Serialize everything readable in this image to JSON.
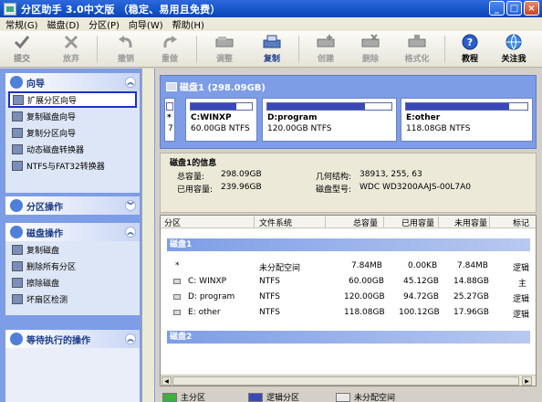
{
  "window": {
    "title": "分区助手 3.0中文版 （稳定、易用且免费）"
  },
  "menu": [
    "常规(G)",
    "磁盘(D)",
    "分区(P)",
    "向导(W)",
    "帮助(H)"
  ],
  "toolbar": {
    "commit": "提交",
    "discard": "放弃",
    "undo": "撤销",
    "redo": "重做",
    "resize": "调整",
    "copy": "复制",
    "create": "创建",
    "delete": "删除",
    "format": "格式化",
    "tutorial": "教程",
    "follow": "关注我"
  },
  "left": {
    "wizard": {
      "title": "向导",
      "items": [
        "扩展分区向导",
        "复制磁盘向导",
        "复制分区向导",
        "动态磁盘转换器",
        "NTFS与FAT32转换器"
      ]
    },
    "partition_ops": {
      "title": "分区操作"
    },
    "disk_ops": {
      "title": "磁盘操作",
      "items": [
        "复制磁盘",
        "删除所有分区",
        "擦除磁盘",
        "坏扇区检测"
      ]
    },
    "pending": {
      "title": "等待执行的操作"
    }
  },
  "diskmap": {
    "title": "磁盘1  (298.09GB)",
    "parts": [
      {
        "label": "*",
        "size": "7"
      },
      {
        "label": "C:WINXP",
        "size": "60.00GB NTFS",
        "used": 0.75
      },
      {
        "label": "D:program",
        "size": "120.00GB NTFS",
        "used": 0.79
      },
      {
        "label": "E:other",
        "size": "118.08GB NTFS",
        "used": 0.85
      }
    ]
  },
  "info": {
    "title": "磁盘1的信息",
    "total_label": "总容量:",
    "total": "298.09GB",
    "used_label": "已用容量:",
    "used": "239.96GB",
    "geo_label": "几何结构:",
    "geo": "38913, 255, 63",
    "model_label": "磁盘型号:",
    "model": "WDC WD3200AAJS-00L7A0"
  },
  "table": {
    "headers": [
      "分区",
      "文件系统",
      "总容量",
      "已用容量",
      "未用容量",
      "标记"
    ],
    "disk1": "磁盘1",
    "disk2": "磁盘2",
    "rows": [
      {
        "name": "*",
        "fs": "未分配空间",
        "total": "7.84MB",
        "used": "0.00KB",
        "free": "7.84MB",
        "flag": "逻辑"
      },
      {
        "name": "C: WINXP",
        "fs": "NTFS",
        "total": "60.00GB",
        "used": "45.12GB",
        "free": "14.88GB",
        "flag": "主"
      },
      {
        "name": "D: program",
        "fs": "NTFS",
        "total": "120.00GB",
        "used": "94.72GB",
        "free": "25.27GB",
        "flag": "逻辑"
      },
      {
        "name": "E: other",
        "fs": "NTFS",
        "total": "118.08GB",
        "used": "100.12GB",
        "free": "17.96GB",
        "flag": "逻辑"
      }
    ]
  },
  "legend": {
    "primary": "主分区",
    "logical": "逻辑分区",
    "unallocated": "未分配空间"
  },
  "colors": {
    "primary": "#3fae3f",
    "logical": "#3b49b8",
    "unallocated": "#e8e8e8",
    "accent": "#7d9de6"
  }
}
